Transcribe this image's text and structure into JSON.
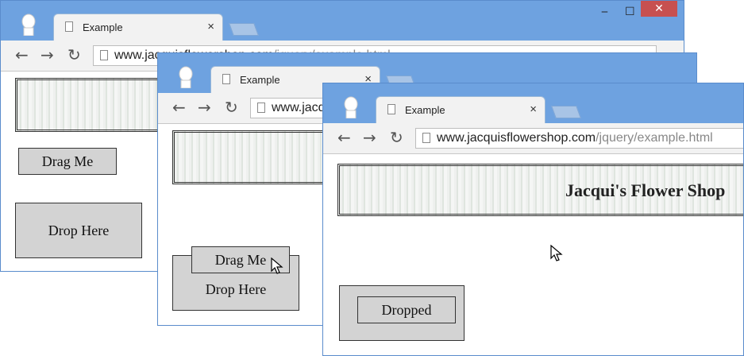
{
  "window1": {
    "tab_title": "Example",
    "tab_close": "×",
    "url_host": "www.jacquisflowershop.com",
    "url_path": "/jquery/example.html",
    "minimize": "‒",
    "maximize": "☐",
    "close": "✕",
    "drag_label": "Drag Me",
    "drop_label": "Drop Here"
  },
  "window2": {
    "tab_title": "Example",
    "tab_close": "×",
    "url_host": "www.jacquisflowershop.com",
    "drag_label": "Drag Me",
    "drop_label": "Drop Here"
  },
  "window3": {
    "tab_title": "Example",
    "tab_close": "×",
    "url_host": "www.jacquisflowershop.com",
    "url_path": "/jquery/example.html",
    "banner_title": "Jacqui's Flower Shop",
    "dropped_label": "Dropped"
  },
  "nav": {
    "back": "←",
    "forward": "→",
    "reload": "↻"
  },
  "icons": [
    "user-avatar-icon",
    "document-icon",
    "back-icon",
    "forward-icon",
    "reload-icon",
    "mouse-cursor-icon"
  ]
}
